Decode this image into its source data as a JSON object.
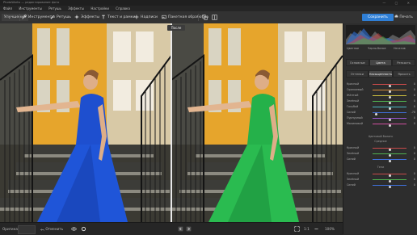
{
  "window": {
    "title": "PhotoWorks — редактирование фото",
    "controls": "— ▢ ✕"
  },
  "menu": [
    "Файл",
    "Инструменты",
    "Ретушь",
    "Эффекты",
    "Настройки",
    "Справка"
  ],
  "toolbar": {
    "items": [
      {
        "label": "Улучшение",
        "icon": "enhance-icon"
      },
      {
        "label": "Инструменты",
        "icon": "tools-icon"
      },
      {
        "label": "Ретушь",
        "icon": "brush-icon"
      },
      {
        "label": "Эффекты",
        "icon": "sparkle-icon"
      },
      {
        "label": "Текст и рамки",
        "icon": "text-icon"
      },
      {
        "label": "Надписи",
        "icon": "plus-icon"
      },
      {
        "label": "Пакетная обработка",
        "icon": "image-icon"
      }
    ],
    "save_label": "Сохранить",
    "print_label": "Печать"
  },
  "canvas": {
    "badge": "После"
  },
  "statusbar": {
    "left_label": "Оригинал",
    "undo_label": "Отменить",
    "zoom": "1:1",
    "zoom_percent": "100%",
    "fit_label": "Вписать"
  },
  "panel": {
    "toggles": [
      "Цветное",
      "Черно-белое",
      "Негатив"
    ],
    "tabs_main": [
      "Основные",
      "Цвета",
      "Резкость"
    ],
    "tabs_sub": [
      "Оттенки",
      "Насыщенность",
      "Яркость"
    ],
    "active_main": 1,
    "active_sub": 1,
    "hue_sliders": [
      {
        "label": "Красный",
        "value": "0"
      },
      {
        "label": "Оранжевый",
        "value": "0"
      },
      {
        "label": "Жёлтый",
        "value": "0"
      },
      {
        "label": "Зелёный",
        "value": "0"
      },
      {
        "label": "Голубой",
        "value": "0"
      },
      {
        "label": "Синий",
        "value": "-78"
      },
      {
        "label": "Пурпурный",
        "value": "0"
      },
      {
        "label": "Малиновый",
        "value": "0"
      }
    ],
    "group1_title": "Цветовой баланс",
    "group1_sub": "Средние",
    "balance_sliders": [
      {
        "label": "Красный",
        "value": "0"
      },
      {
        "label": "Зелёный",
        "value": "0"
      },
      {
        "label": "Синий",
        "value": "0"
      }
    ],
    "group2_title": "Тени",
    "shadow_sliders": [
      {
        "label": "Красный",
        "value": "0"
      },
      {
        "label": "Зелёный",
        "value": "0"
      },
      {
        "label": "Синий",
        "value": "0"
      }
    ]
  },
  "colors": {
    "accent": "#2f7fd6",
    "panel": "#2d2d2d",
    "toolbar": "#323232"
  }
}
